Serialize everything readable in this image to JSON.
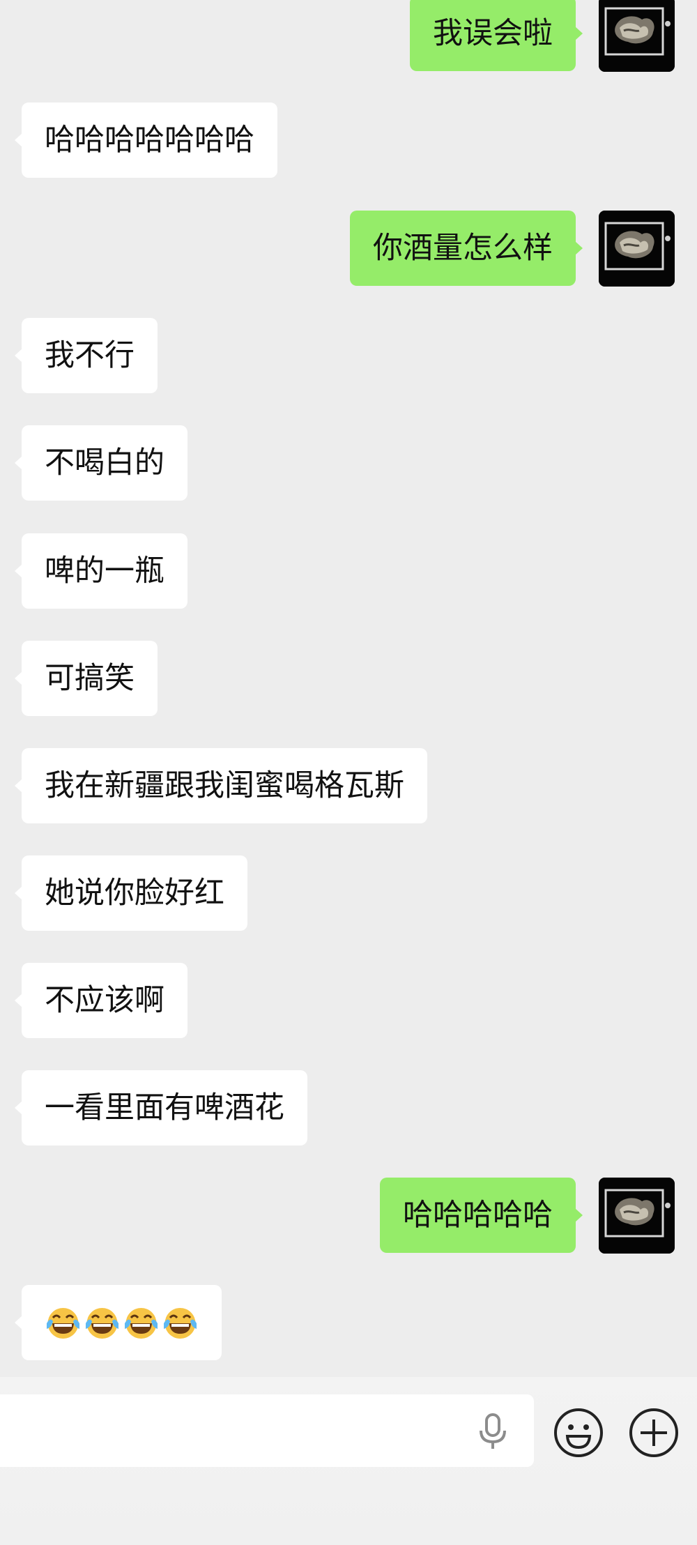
{
  "chat": {
    "messages": [
      {
        "side": "out",
        "text": "我误会啦"
      },
      {
        "side": "in",
        "text": "哈哈哈哈哈哈哈"
      },
      {
        "side": "out",
        "text": "你酒量怎么样"
      },
      {
        "side": "in",
        "text": "我不行"
      },
      {
        "side": "in",
        "text": "不喝白的"
      },
      {
        "side": "in",
        "text": "啤的一瓶"
      },
      {
        "side": "in",
        "text": "可搞笑"
      },
      {
        "side": "in",
        "text": "我在新疆跟我闺蜜喝格瓦斯"
      },
      {
        "side": "in",
        "text": "她说你脸好红"
      },
      {
        "side": "in",
        "text": "不应该啊"
      },
      {
        "side": "in",
        "text": "一看里面有啤酒花"
      },
      {
        "side": "out",
        "text": "哈哈哈哈哈"
      },
      {
        "side": "in",
        "emojis": [
          "tears-of-joy-emoji",
          "tears-of-joy-emoji",
          "tears-of-joy-emoji",
          "tears-of-joy-emoji"
        ]
      }
    ]
  },
  "input_bar": {
    "voice_icon": "microphone-icon",
    "emoji_icon": "smiley-face-icon",
    "more_icon": "plus-circle-icon"
  },
  "colors": {
    "background": "#ededed",
    "incoming_bubble": "#ffffff",
    "outgoing_bubble": "#95ec69",
    "text": "#111111",
    "icon": "#222222"
  }
}
